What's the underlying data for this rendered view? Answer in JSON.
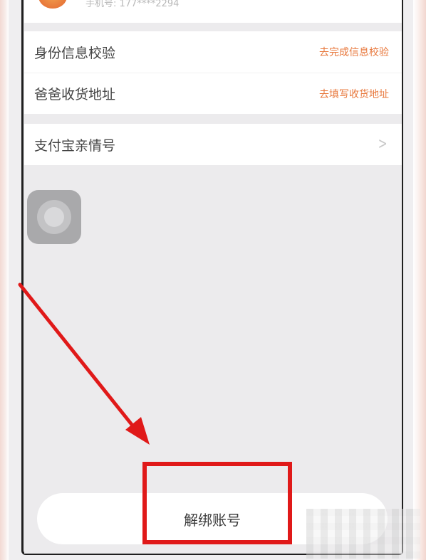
{
  "profile": {
    "phone_label": "手机号: 177****2294"
  },
  "info_group": {
    "items": [
      {
        "label": "身份信息校验",
        "action": "去完成信息校验"
      },
      {
        "label": "爸爸收货地址",
        "action": "去填写收货地址"
      }
    ]
  },
  "alipay_group": {
    "label": "支付宝亲情号"
  },
  "unbind": {
    "label": "解绑账号"
  },
  "colors": {
    "accent": "#e8793e",
    "annotation": "#e01919"
  }
}
